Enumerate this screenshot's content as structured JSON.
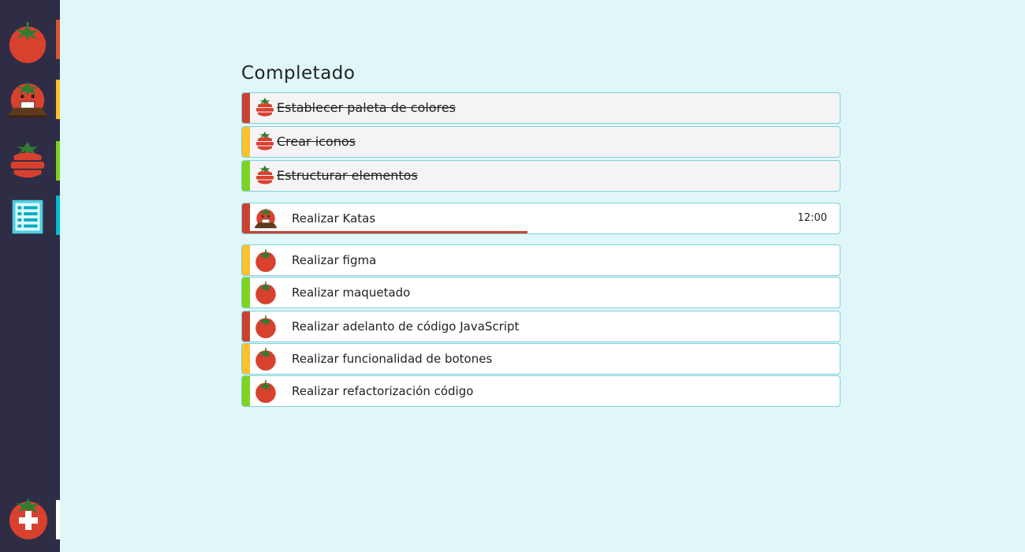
{
  "colors": {
    "background": "#e0f7fa",
    "sidebar": "#2e2d45",
    "red": "#c9422f",
    "yellow": "#fbc02d",
    "green": "#7ed321",
    "cyan": "#00bcd4",
    "border": "#7fd0dc"
  },
  "sidebar": {
    "items": [
      {
        "name": "tomato-icon",
        "accent": "#d9542f"
      },
      {
        "name": "tomato-laptop-icon",
        "accent": "#fbc02d"
      },
      {
        "name": "tomato-stack-icon",
        "accent": "#7ed321"
      },
      {
        "name": "list-icon",
        "accent": "#00bcd4"
      }
    ],
    "add": {
      "name": "add-tomato-icon",
      "accent": "#ffffff"
    }
  },
  "completed": {
    "title": "Completado",
    "tasks": [
      {
        "label": "Establecer paleta de colores",
        "color": "#c9422f",
        "icon": "tomato-stack-icon"
      },
      {
        "label": "Crear iconos",
        "color": "#fbc02d",
        "icon": "tomato-stack-icon"
      },
      {
        "label": "Estructurar elementos",
        "color": "#7ed321",
        "icon": "tomato-stack-icon"
      }
    ]
  },
  "current": {
    "label": "Realizar Katas",
    "time": "12:00",
    "color": "#c9422f",
    "icon": "tomato-laptop-icon",
    "progress": 0.47
  },
  "pending": [
    {
      "label": "Realizar figma",
      "color": "#fbc02d",
      "icon": "tomato-icon"
    },
    {
      "label": "Realizar maquetado",
      "color": "#7ed321",
      "icon": "tomato-icon"
    },
    {
      "label": "Realizar adelanto de código  JavaScript",
      "color": "#c9422f",
      "icon": "tomato-icon"
    },
    {
      "label": "Realizar funcionalidad de botones",
      "color": "#fbc02d",
      "icon": "tomato-icon"
    },
    {
      "label": "Realizar refactorización código",
      "color": "#7ed321",
      "icon": "tomato-icon"
    }
  ]
}
